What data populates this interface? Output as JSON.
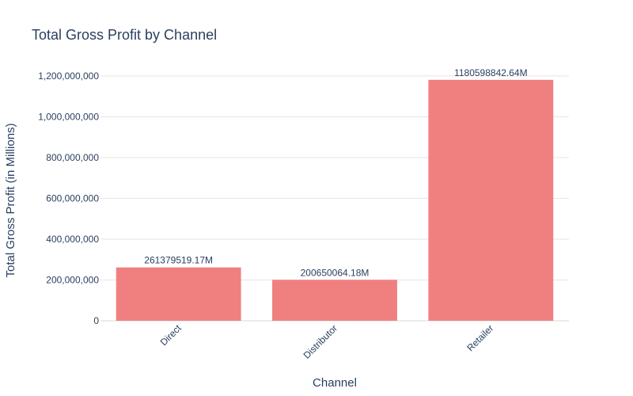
{
  "chart_data": {
    "type": "bar",
    "title": "Total Gross Profit by Channel",
    "xlabel": "Channel",
    "ylabel": "Total Gross Profit (in Millions)",
    "categories": [
      "Direct",
      "Distributor",
      "Retailer"
    ],
    "values": [
      261379519.17,
      200650064.18,
      1180598842.64
    ],
    "data_labels": [
      "261379519.17M",
      "200650064.18M",
      "1180598842.64M"
    ],
    "ylim": [
      0,
      1242000000
    ],
    "yticks": [
      0,
      200000000,
      400000000,
      600000000,
      800000000,
      1000000000,
      1200000000
    ],
    "ytick_labels": [
      "0",
      "200,000,000",
      "400,000,000",
      "600,000,000",
      "800,000,000",
      "1,000,000,000",
      "1,200,000,000"
    ],
    "grid": true,
    "bar_color": "#f08080",
    "text_color": "#2a3f5f",
    "grid_color": "#e5e5e5"
  }
}
